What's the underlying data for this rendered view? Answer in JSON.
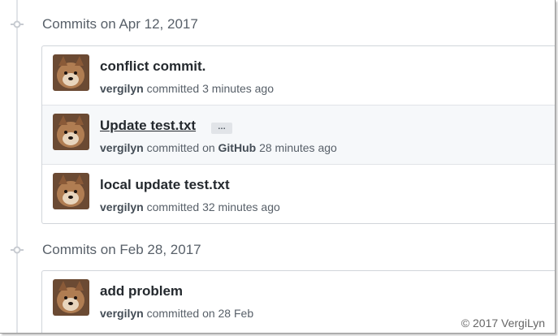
{
  "groups": [
    {
      "title": "Commits on Apr 12, 2017",
      "commits": [
        {
          "title": "conflict commit.",
          "author": "vergilyn",
          "action": "committed",
          "platform_prefix": "",
          "platform": "",
          "time": "3 minutes ago"
        },
        {
          "title": "Update test.txt",
          "ellipsis": "…",
          "author": "vergilyn",
          "action": "committed",
          "platform_prefix": "on",
          "platform": "GitHub",
          "time": "28 minutes ago"
        },
        {
          "title": "local update test.txt",
          "author": "vergilyn",
          "action": "committed",
          "platform_prefix": "",
          "platform": "",
          "time": "32 minutes ago"
        }
      ]
    },
    {
      "title": "Commits on Feb 28, 2017",
      "commits": [
        {
          "title": "add problem",
          "author": "vergilyn",
          "action": "committed",
          "platform_prefix": "",
          "platform": "",
          "time": "on 28 Feb"
        }
      ]
    }
  ],
  "watermark": "© 2017 VergiLyn",
  "colors": {
    "timeline": "#e1e4e8",
    "highlight_row": "#f6f8fa",
    "border": "#d1d5da"
  }
}
